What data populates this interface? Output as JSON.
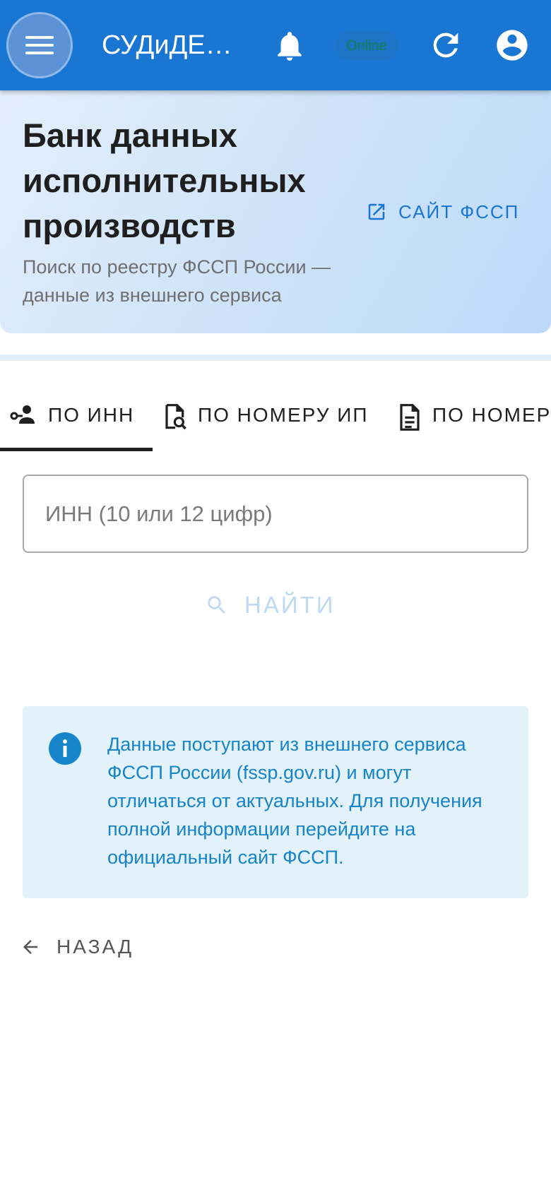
{
  "appbar": {
    "title": "СУДиДЕЛО",
    "status_badge": "Online",
    "icons": [
      "menu-icon",
      "bell-icon",
      "refresh-icon",
      "account-icon"
    ]
  },
  "header": {
    "title": "Банк данных исполнительных производств",
    "subtitle": "Поиск по реестру ФССП России — данные из внешнего сервиса",
    "link_label": "САЙТ ФССП"
  },
  "tabs": [
    {
      "label": "ПО ИНН",
      "icon": "person-key-icon",
      "active": true
    },
    {
      "label": "ПО НОМЕРУ ИП",
      "icon": "document-search-icon",
      "active": false
    },
    {
      "label": "ПО НОМЕРУ",
      "icon": "document-icon",
      "active": false
    }
  ],
  "search": {
    "placeholder": "ИНН (10 или 12 цифр)",
    "value": "",
    "button_label": "НАЙТИ"
  },
  "info": {
    "text": "Данные поступают из внешнего сервиса ФССП России (fssp.gov.ru) и могут отличаться от актуальных. Для получения полной информации перейдите на официальный сайт ФССП."
  },
  "footer": {
    "back_label": "НАЗАД"
  },
  "colors": {
    "primary": "#1976d2",
    "info_bg": "#e3f1fa",
    "info_text": "#1684c8"
  }
}
